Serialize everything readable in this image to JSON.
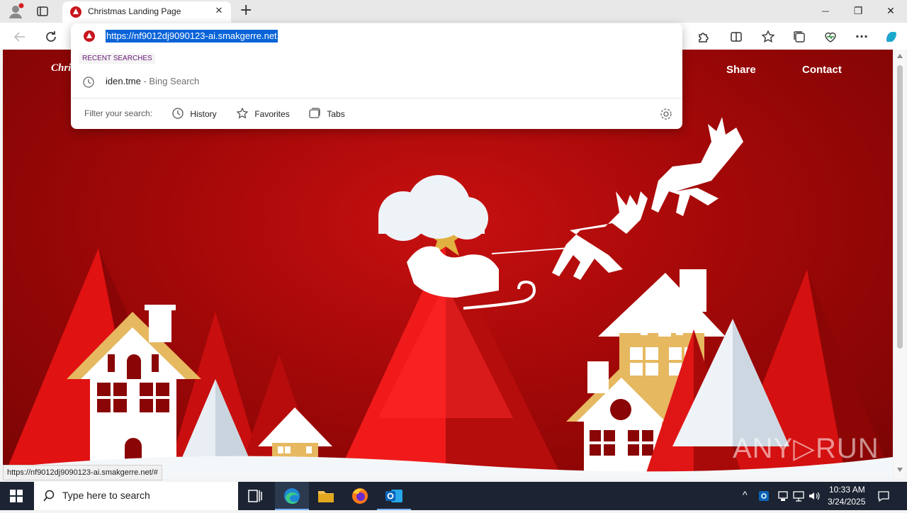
{
  "browser": {
    "tab_title": "Christmas Landing Page",
    "tab_close": "✕",
    "new_tab": "+",
    "window_controls": {
      "minimize": "—",
      "maximize": "❐",
      "close": "✕"
    }
  },
  "toolbar": {
    "icons": [
      "back-icon",
      "refresh-icon",
      "extensions-icon",
      "split-screen-icon",
      "favorites-icon",
      "collections-icon",
      "browser-essentials-icon",
      "more-icon",
      "copilot-icon"
    ],
    "more_label": "···"
  },
  "omnibox": {
    "url": "https://nf9012dj9090123-ai.smakgerre.net",
    "recent_header": "RECENT SEARCHES",
    "suggestion": {
      "text": "iden.tme",
      "suffix": " - Bing Search"
    },
    "filter_label": "Filter your search:",
    "filters": [
      "History",
      "Favorites",
      "Tabs"
    ]
  },
  "page": {
    "brand": "Chri",
    "nav": [
      "Share",
      "Contact"
    ],
    "watermark": "ANY▷RUN"
  },
  "status_url": "https://nf9012dj9090123-ai.smakgerre.net/#",
  "taskbar": {
    "search_placeholder": "Type here to search",
    "time": "10:33 AM",
    "date": "3/24/2025"
  },
  "colors": {
    "page_red": "#b00a0a",
    "selection_blue": "#0a64d8",
    "taskbar": "#1c2433"
  }
}
